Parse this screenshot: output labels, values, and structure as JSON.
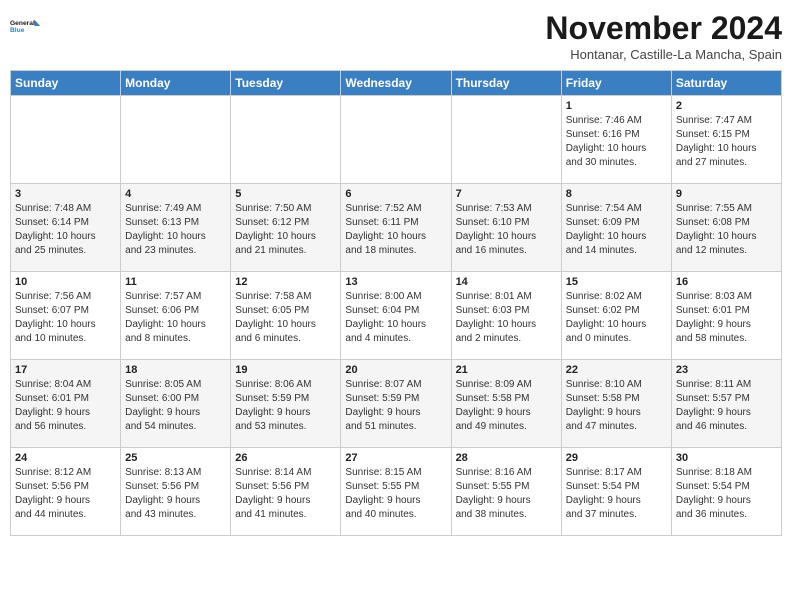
{
  "header": {
    "logo_line1": "General",
    "logo_line2": "Blue",
    "month": "November 2024",
    "location": "Hontanar, Castille-La Mancha, Spain"
  },
  "weekdays": [
    "Sunday",
    "Monday",
    "Tuesday",
    "Wednesday",
    "Thursday",
    "Friday",
    "Saturday"
  ],
  "weeks": [
    [
      {
        "day": "",
        "info": ""
      },
      {
        "day": "",
        "info": ""
      },
      {
        "day": "",
        "info": ""
      },
      {
        "day": "",
        "info": ""
      },
      {
        "day": "",
        "info": ""
      },
      {
        "day": "1",
        "info": "Sunrise: 7:46 AM\nSunset: 6:16 PM\nDaylight: 10 hours\nand 30 minutes."
      },
      {
        "day": "2",
        "info": "Sunrise: 7:47 AM\nSunset: 6:15 PM\nDaylight: 10 hours\nand 27 minutes."
      }
    ],
    [
      {
        "day": "3",
        "info": "Sunrise: 7:48 AM\nSunset: 6:14 PM\nDaylight: 10 hours\nand 25 minutes."
      },
      {
        "day": "4",
        "info": "Sunrise: 7:49 AM\nSunset: 6:13 PM\nDaylight: 10 hours\nand 23 minutes."
      },
      {
        "day": "5",
        "info": "Sunrise: 7:50 AM\nSunset: 6:12 PM\nDaylight: 10 hours\nand 21 minutes."
      },
      {
        "day": "6",
        "info": "Sunrise: 7:52 AM\nSunset: 6:11 PM\nDaylight: 10 hours\nand 18 minutes."
      },
      {
        "day": "7",
        "info": "Sunrise: 7:53 AM\nSunset: 6:10 PM\nDaylight: 10 hours\nand 16 minutes."
      },
      {
        "day": "8",
        "info": "Sunrise: 7:54 AM\nSunset: 6:09 PM\nDaylight: 10 hours\nand 14 minutes."
      },
      {
        "day": "9",
        "info": "Sunrise: 7:55 AM\nSunset: 6:08 PM\nDaylight: 10 hours\nand 12 minutes."
      }
    ],
    [
      {
        "day": "10",
        "info": "Sunrise: 7:56 AM\nSunset: 6:07 PM\nDaylight: 10 hours\nand 10 minutes."
      },
      {
        "day": "11",
        "info": "Sunrise: 7:57 AM\nSunset: 6:06 PM\nDaylight: 10 hours\nand 8 minutes."
      },
      {
        "day": "12",
        "info": "Sunrise: 7:58 AM\nSunset: 6:05 PM\nDaylight: 10 hours\nand 6 minutes."
      },
      {
        "day": "13",
        "info": "Sunrise: 8:00 AM\nSunset: 6:04 PM\nDaylight: 10 hours\nand 4 minutes."
      },
      {
        "day": "14",
        "info": "Sunrise: 8:01 AM\nSunset: 6:03 PM\nDaylight: 10 hours\nand 2 minutes."
      },
      {
        "day": "15",
        "info": "Sunrise: 8:02 AM\nSunset: 6:02 PM\nDaylight: 10 hours\nand 0 minutes."
      },
      {
        "day": "16",
        "info": "Sunrise: 8:03 AM\nSunset: 6:01 PM\nDaylight: 9 hours\nand 58 minutes."
      }
    ],
    [
      {
        "day": "17",
        "info": "Sunrise: 8:04 AM\nSunset: 6:01 PM\nDaylight: 9 hours\nand 56 minutes."
      },
      {
        "day": "18",
        "info": "Sunrise: 8:05 AM\nSunset: 6:00 PM\nDaylight: 9 hours\nand 54 minutes."
      },
      {
        "day": "19",
        "info": "Sunrise: 8:06 AM\nSunset: 5:59 PM\nDaylight: 9 hours\nand 53 minutes."
      },
      {
        "day": "20",
        "info": "Sunrise: 8:07 AM\nSunset: 5:59 PM\nDaylight: 9 hours\nand 51 minutes."
      },
      {
        "day": "21",
        "info": "Sunrise: 8:09 AM\nSunset: 5:58 PM\nDaylight: 9 hours\nand 49 minutes."
      },
      {
        "day": "22",
        "info": "Sunrise: 8:10 AM\nSunset: 5:58 PM\nDaylight: 9 hours\nand 47 minutes."
      },
      {
        "day": "23",
        "info": "Sunrise: 8:11 AM\nSunset: 5:57 PM\nDaylight: 9 hours\nand 46 minutes."
      }
    ],
    [
      {
        "day": "24",
        "info": "Sunrise: 8:12 AM\nSunset: 5:56 PM\nDaylight: 9 hours\nand 44 minutes."
      },
      {
        "day": "25",
        "info": "Sunrise: 8:13 AM\nSunset: 5:56 PM\nDaylight: 9 hours\nand 43 minutes."
      },
      {
        "day": "26",
        "info": "Sunrise: 8:14 AM\nSunset: 5:56 PM\nDaylight: 9 hours\nand 41 minutes."
      },
      {
        "day": "27",
        "info": "Sunrise: 8:15 AM\nSunset: 5:55 PM\nDaylight: 9 hours\nand 40 minutes."
      },
      {
        "day": "28",
        "info": "Sunrise: 8:16 AM\nSunset: 5:55 PM\nDaylight: 9 hours\nand 38 minutes."
      },
      {
        "day": "29",
        "info": "Sunrise: 8:17 AM\nSunset: 5:54 PM\nDaylight: 9 hours\nand 37 minutes."
      },
      {
        "day": "30",
        "info": "Sunrise: 8:18 AM\nSunset: 5:54 PM\nDaylight: 9 hours\nand 36 minutes."
      }
    ]
  ]
}
